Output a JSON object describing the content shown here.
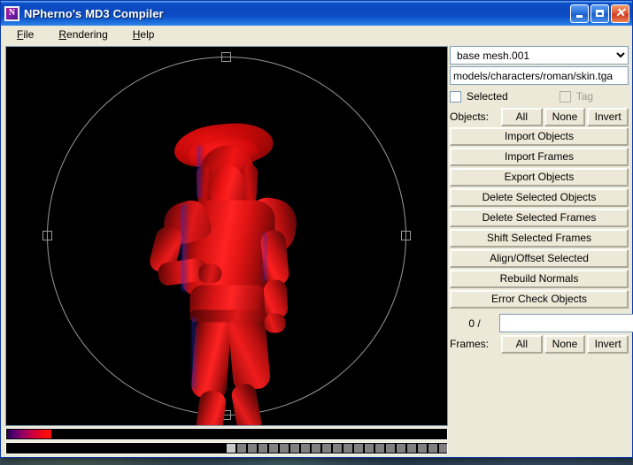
{
  "window": {
    "title": "NPherno's MD3 Compiler",
    "icon": "app-icon-n",
    "icon_letter": "N",
    "caption": {
      "minimize": "minimize-icon",
      "maximize": "maximize-icon",
      "close": "close-icon"
    }
  },
  "menubar": {
    "items": [
      {
        "label": "File",
        "accel": "F"
      },
      {
        "label": "Rendering",
        "accel": "R"
      },
      {
        "label": "Help",
        "accel": "H"
      }
    ]
  },
  "viewport": {
    "background_color": "#000000",
    "selection_circle_color": "#9a9a9a",
    "model_name": "roman soldier",
    "model_color": "#ff2020",
    "handles": [
      "top",
      "right",
      "bottom",
      "left"
    ]
  },
  "timeline": {
    "progress_percent": 10,
    "progress_gradient_start": "#2a0050",
    "progress_gradient_end": "#ff1010",
    "frame_count": 22,
    "current_frame_index": 0,
    "frame_cell_color": "#808080",
    "frame_cell_current_color": "#c8c8c8"
  },
  "panel": {
    "mesh_select": {
      "value": "base mesh.001",
      "options": [
        "base mesh.001"
      ]
    },
    "skin_path": {
      "value": "models/characters/roman/skin.tga",
      "placeholder": ""
    },
    "selected_checkbox": {
      "label": "Selected",
      "checked": false
    },
    "tag_checkbox": {
      "label": "Tag",
      "checked": false,
      "disabled": true
    },
    "objects_row": {
      "label": "Objects:",
      "all": "All",
      "none": "None",
      "invert": "Invert"
    },
    "actions": [
      "Import Objects",
      "Import Frames",
      "Export Objects",
      "Delete Selected Objects",
      "Delete Selected Frames",
      "Shift Selected Frames",
      "Align/Offset Selected",
      "Rebuild Normals",
      "Error Check Objects"
    ],
    "frames_count_label": "0 /",
    "frames_input_value": "",
    "frames_row": {
      "label": "Frames:",
      "all": "All",
      "none": "None",
      "invert": "Invert"
    }
  },
  "colors": {
    "titlebar_blue": "#0b3fbe",
    "panel_face": "#ece9d8",
    "button_face": "#ece9d8",
    "field_border": "#7f9db9"
  }
}
